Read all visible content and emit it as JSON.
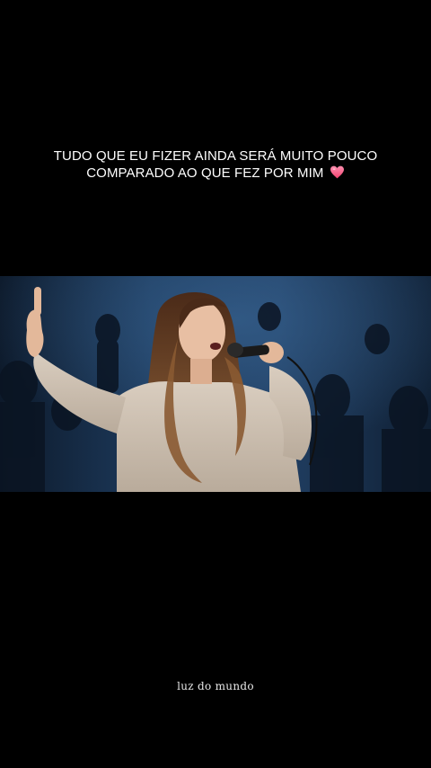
{
  "caption": {
    "line1": "TUDO QUE EU FIZER AINDA SERÁ MUITO POUCO",
    "line2": "COMPARADO AO QUE FEZ POR MIM",
    "emoji": "pink-heart"
  },
  "video": {
    "content": "worship-singer-performance"
  },
  "watermark": {
    "text": "luz do mundo"
  },
  "colors": {
    "background": "#000000",
    "caption_text": "#ffffff",
    "heart": "#ff5c8a",
    "stage_blue": "#1d3a5c"
  }
}
